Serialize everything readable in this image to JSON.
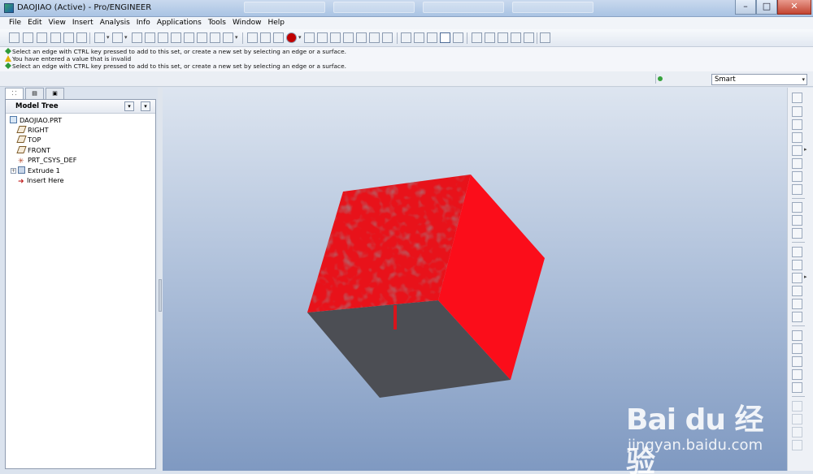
{
  "window": {
    "title": "DAOJIAO (Active) - Pro/ENGINEER",
    "controls": {
      "minimize": "–",
      "maximize": "□",
      "close": "✕"
    }
  },
  "menu": [
    "File",
    "Edit",
    "View",
    "Insert",
    "Analysis",
    "Info",
    "Applications",
    "Tools",
    "Window",
    "Help"
  ],
  "messages": [
    {
      "type": "ok",
      "text": "Select an edge with CTRL key pressed to add to this set, or create a new set by selecting an edge or a surface."
    },
    {
      "type": "warn",
      "text": "You have entered a value that is invalid"
    },
    {
      "type": "ok",
      "text": "Select an edge with CTRL key pressed to add to this set, or create a new set by selecting an edge or a surface."
    }
  ],
  "filter": {
    "value": "Smart"
  },
  "model_tree": {
    "title": "Model Tree",
    "items": [
      {
        "label": "DAOJIAO.PRT",
        "icon": "part-icon"
      },
      {
        "label": "RIGHT",
        "icon": "datum-plane-icon"
      },
      {
        "label": "TOP",
        "icon": "datum-plane-icon"
      },
      {
        "label": "FRONT",
        "icon": "datum-plane-icon"
      },
      {
        "label": "PRT_CSYS_DEF",
        "icon": "csys-icon"
      },
      {
        "label": "Extrude 1",
        "icon": "extrude-icon"
      },
      {
        "label": "Insert Here",
        "icon": "insert-here-icon"
      }
    ]
  },
  "model": {
    "top_face_color": "#e8121a",
    "right_face_color": "#fb0d1a",
    "front_face_color": "#4c4e54"
  },
  "watermark": {
    "logo": "Bai du 经验",
    "url": "jingyan.baidu.com"
  }
}
